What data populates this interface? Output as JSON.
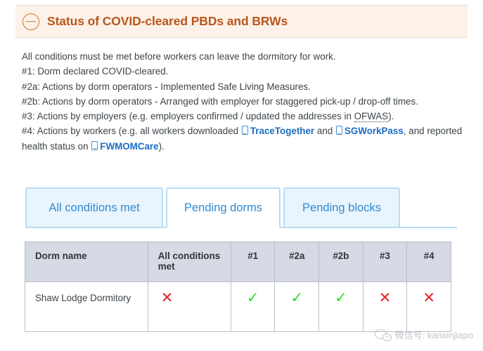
{
  "panel": {
    "title": "Status of COVID-cleared PBDs and BRWs",
    "collapse_icon": "circle-minus-icon",
    "accent_color": "#b9571c",
    "header_background": "#fdf2e9"
  },
  "description": {
    "intro": "All conditions must be met before workers can leave the dormitory for work.",
    "item1": "#1: Dorm declared COVID-cleared.",
    "item2a": "#2a: Actions by dorm operators - Implemented Safe Living Measures.",
    "item2b": "#2b: Actions by dorm operators - Arranged with employer for staggered pick-up / drop-off times.",
    "item3_pre": "#3: Actions by employers (e.g. employers confirmed / updated the addresses in ",
    "item3_abbr": "OFWAS",
    "item3_post": ").",
    "item4_pre": "#4: Actions by workers (e.g. all workers downloaded ",
    "item4_link1": "TraceTogether",
    "item4_mid": " and ",
    "item4_link2": "SGWorkPass",
    "item4_mid2": ", and reported health status on ",
    "item4_link3": "FWMOMCare",
    "item4_post": ").",
    "link_color": "#1b6ec2",
    "app_icon": "mobile-phone-icon"
  },
  "tabs": {
    "items": [
      {
        "label": "All conditions met",
        "active": false
      },
      {
        "label": "Pending dorms",
        "active": true
      },
      {
        "label": "Pending blocks",
        "active": false
      }
    ],
    "border_color": "#b8ddf5",
    "text_color": "#2e8bd4"
  },
  "table": {
    "headers": [
      "Dorm name",
      "All conditions met",
      "#1",
      "#2a",
      "#2b",
      "#3",
      "#4"
    ],
    "header_background": "#d5dae4",
    "rows": [
      {
        "dorm_name": "Shaw Lodge Dormitory",
        "all_conditions_met": "✕",
        "c1": "✓",
        "c2a": "✓",
        "c2b": "✓",
        "c3": "✕",
        "c4": "✕"
      }
    ],
    "cross_color": "#e8202a",
    "tick_color": "#2ae01f"
  },
  "watermark": {
    "text": "微信号: kanxinjiapo",
    "icon": "wechat-icon"
  }
}
